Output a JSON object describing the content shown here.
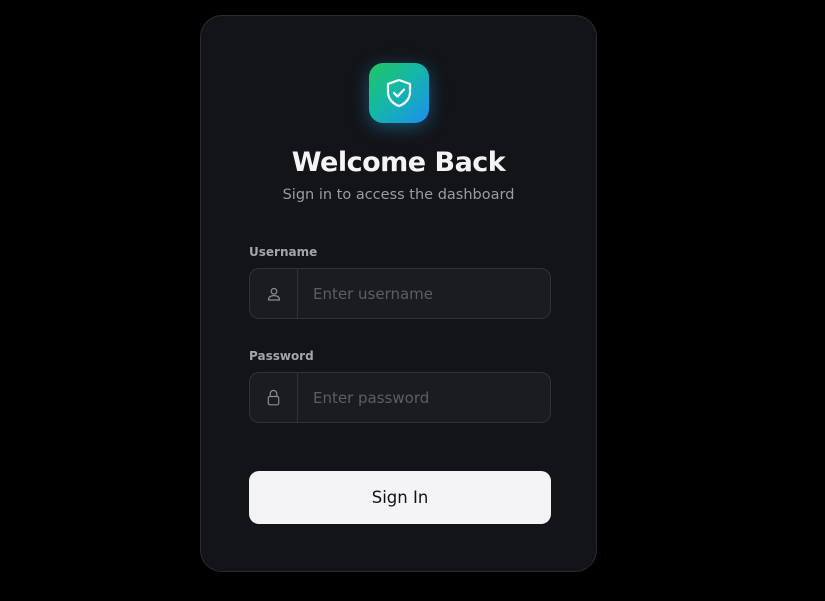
{
  "login": {
    "logo_icon": "shield-check-icon",
    "title": "Welcome Back",
    "subtitle": "Sign in to access the dashboard",
    "username": {
      "label": "Username",
      "placeholder": "Enter username",
      "value": "",
      "icon": "user-icon"
    },
    "password": {
      "label": "Password",
      "placeholder": "Enter password",
      "value": "",
      "icon": "lock-icon"
    },
    "submit_label": "Sign In"
  },
  "colors": {
    "background": "#000000",
    "card": "#131417",
    "input_bg": "#1b1c20",
    "accent_start": "#22c55e",
    "accent_end": "#1d8ff0",
    "button_bg": "#f4f4f6",
    "button_text": "#111216"
  }
}
